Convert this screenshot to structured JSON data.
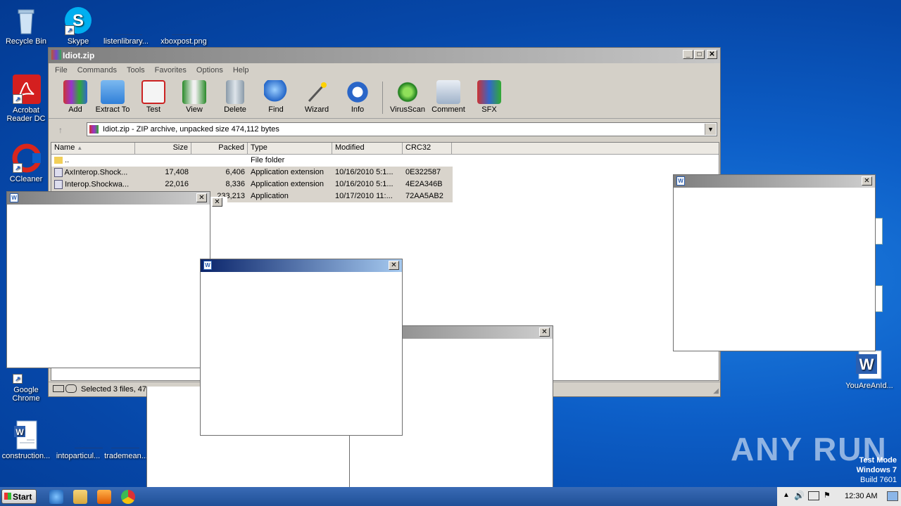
{
  "desktop_icons": [
    {
      "label": "Recycle Bin"
    },
    {
      "label": "Skype"
    },
    {
      "label": "listenlibrary..."
    },
    {
      "label": "xboxpost.png"
    },
    {
      "label": "Acrobat Reader DC"
    },
    {
      "label": "CCleaner"
    },
    {
      "label": "Google Chrome"
    },
    {
      "label": "construction..."
    },
    {
      "label": "intoparticul..."
    },
    {
      "label": "trademean..."
    },
    {
      "label": "YouAreAnId..."
    }
  ],
  "winrar": {
    "title": "Idiot.zip",
    "menu": [
      "File",
      "Commands",
      "Tools",
      "Favorites",
      "Options",
      "Help"
    ],
    "toolbar": [
      "Add",
      "Extract To",
      "Test",
      "View",
      "Delete",
      "Find",
      "Wizard",
      "Info",
      "VirusScan",
      "Comment",
      "SFX"
    ],
    "address": "Idiot.zip - ZIP archive, unpacked size 474,112 bytes",
    "columns": [
      "Name",
      "Size",
      "Packed",
      "Type",
      "Modified",
      "CRC32"
    ],
    "rows": [
      {
        "name": "..",
        "size": "",
        "packed": "",
        "type": "File folder",
        "modified": "",
        "crc": ""
      },
      {
        "name": "AxInterop.Shock...",
        "size": "17,408",
        "packed": "6,406",
        "type": "Application extension",
        "modified": "10/16/2010 5:1...",
        "crc": "0E322587"
      },
      {
        "name": "Interop.Shockwa...",
        "size": "22,016",
        "packed": "8,336",
        "type": "Application extension",
        "modified": "10/16/2010 5:1...",
        "crc": "4E2A346B"
      },
      {
        "name": "",
        "size": "",
        "packed": "233,213",
        "type": "Application",
        "modified": "10/17/2010 11:...",
        "crc": "72AA5AB2"
      }
    ],
    "status": "Selected 3 files, 47"
  },
  "taskbar": {
    "start_label": "Start",
    "time": "12:30 AM"
  },
  "watermark": {
    "text": "ANY RUN",
    "test_mode": "Test Mode",
    "os": "Windows 7",
    "build": "Build 7601"
  },
  "colors": {
    "accent_active_title": "#0a246a",
    "desktop": "#0d5fc8"
  }
}
